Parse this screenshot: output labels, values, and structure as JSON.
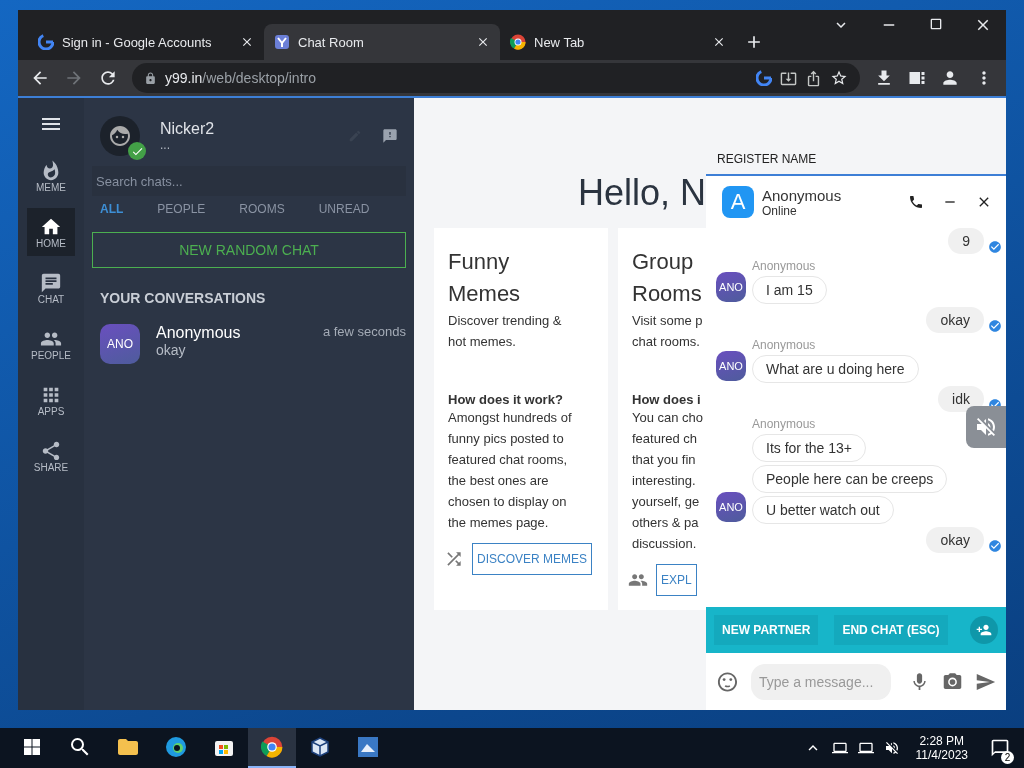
{
  "browser": {
    "tabs": [
      {
        "title": "Sign in - Google Accounts",
        "selected": false
      },
      {
        "title": "Chat Room",
        "selected": true
      },
      {
        "title": "New Tab",
        "selected": false
      }
    ],
    "address": {
      "host": "y99.in",
      "path": "/web/desktop/intro"
    },
    "forward_disabled": true
  },
  "app": {
    "rail": [
      {
        "label": "MEME",
        "selected": false
      },
      {
        "label": "HOME",
        "selected": true
      },
      {
        "label": "CHAT",
        "selected": false
      },
      {
        "label": "PEOPLE",
        "selected": false
      },
      {
        "label": "APPS",
        "selected": false
      },
      {
        "label": "SHARE",
        "selected": false
      }
    ],
    "profile": {
      "name": "Nicker2",
      "status": "...",
      "online": true
    },
    "search": {
      "placeholder": "Search chats..."
    },
    "filters": [
      {
        "label": "ALL",
        "selected": true
      },
      {
        "label": "PEOPLE",
        "selected": false
      },
      {
        "label": "ROOMS",
        "selected": false
      },
      {
        "label": "UNREAD",
        "selected": false
      }
    ],
    "random_chat_button": "NEW RANDOM CHAT",
    "conversations_heading": "YOUR CONVERSATIONS",
    "conversations": [
      {
        "avatar": "ANO",
        "name": "Anonymous",
        "last_message": "okay",
        "time": "a few seconds"
      }
    ]
  },
  "main": {
    "greeting": "Hello, N",
    "register": "REGISTER NAME",
    "cards": [
      {
        "title_lines": [
          "Funny",
          "Memes"
        ],
        "intro_lines": [
          "Discover trending &",
          "hot memes."
        ],
        "how_heading": "How does it work?",
        "body_lines": [
          "Amongst hundreds of",
          "funny pics posted to",
          "featured chat rooms,",
          "the best ones are",
          "chosen to display on",
          "the memes page."
        ],
        "button": "DISCOVER MEMES"
      },
      {
        "title_lines": [
          "Group",
          "Rooms"
        ],
        "intro_lines": [
          "Visit some p",
          "chat rooms."
        ],
        "how_heading": "How does i",
        "body_lines": [
          "You can cho",
          "featured ch",
          "that you fin",
          "interesting.",
          "yourself, ge",
          "others & pa",
          "discussion."
        ],
        "button": "EXPL"
      }
    ]
  },
  "chat": {
    "partner": {
      "avatar": "A",
      "name": "Anonymous",
      "status": "Online"
    },
    "messages": [
      {
        "kind": "outgoing",
        "text": "9",
        "read": true
      },
      {
        "kind": "incoming",
        "sender": "Anonymous",
        "avatar": "ANO",
        "bubbles": [
          "I am 15"
        ]
      },
      {
        "kind": "outgoing",
        "text": "okay",
        "read": true
      },
      {
        "kind": "incoming",
        "sender": "Anonymous",
        "avatar": "ANO",
        "bubbles": [
          "What are u doing here"
        ]
      },
      {
        "kind": "outgoing",
        "text": "idk",
        "read": true
      },
      {
        "kind": "incoming",
        "sender": "Anonymous",
        "avatar": "ANO",
        "bubbles": [
          "Its for the 13+",
          "People here can be creeps",
          "U better watch out"
        ]
      },
      {
        "kind": "outgoing",
        "text": "okay",
        "read": true
      }
    ],
    "actions": [
      "NEW PARTNER",
      "END CHAT (ESC)"
    ],
    "input": {
      "placeholder": "Type a message..."
    }
  },
  "taskbar": {
    "apps": [
      {
        "kind": "explorer",
        "active": false
      },
      {
        "kind": "edge",
        "active": false
      },
      {
        "kind": "store",
        "active": false
      },
      {
        "kind": "chrome",
        "active": true
      },
      {
        "kind": "cube",
        "active": false
      },
      {
        "kind": "xp",
        "active": false
      }
    ],
    "time": "2:28 PM",
    "date": "11/4/2023",
    "notifications": "2"
  }
}
